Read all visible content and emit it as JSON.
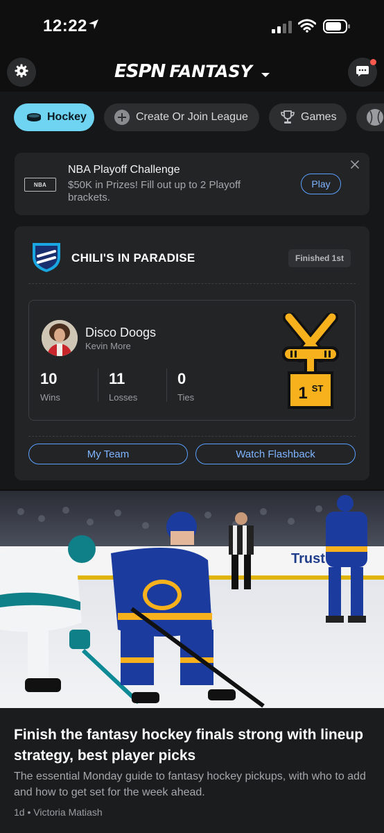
{
  "status_bar": {
    "time": "12:22"
  },
  "header": {
    "logo_espn": "ESPN",
    "logo_fantasy": "FANTASY"
  },
  "chips": [
    {
      "label": "Hockey",
      "icon": "puck-icon",
      "active": true
    },
    {
      "label": "Create Or Join League",
      "icon": "plus-circle-icon",
      "active": false
    },
    {
      "label": "Games",
      "icon": "trophy-icon",
      "active": false
    },
    {
      "label": "",
      "icon": "baseball-icon",
      "active": false
    }
  ],
  "promo": {
    "logo_text": "NBA",
    "title": "NBA Playoff Challenge",
    "description": "$50K in Prizes! Fill out up to 2 Playoff brackets.",
    "play_label": "Play"
  },
  "league": {
    "name": "CHILI'S IN PARADISE",
    "badge": "Finished 1st",
    "team": {
      "name": "Disco Doogs",
      "owner": "Kevin More",
      "stats": [
        {
          "value": "10",
          "label": "Wins"
        },
        {
          "value": "11",
          "label": "Losses"
        },
        {
          "value": "0",
          "label": "Ties"
        }
      ],
      "place_label": "1",
      "place_suffix": "ST"
    },
    "buttons": {
      "my_team": "My Team",
      "flashback": "Watch Flashback"
    }
  },
  "article": {
    "headline": "Finish the fantasy hockey finals strong with lineup strategy, best player picks",
    "summary": "The essential Monday guide to fantasy hockey pickups, with who to add and how to get set for the week ahead.",
    "age": "1d",
    "author": "Victoria Matiash",
    "photo_text": "Trust"
  },
  "colors": {
    "accent": "#6fd4f2",
    "link": "#5aa0ff",
    "trophy": "#f6b11c",
    "sabres_blue": "#1b3c9e"
  }
}
